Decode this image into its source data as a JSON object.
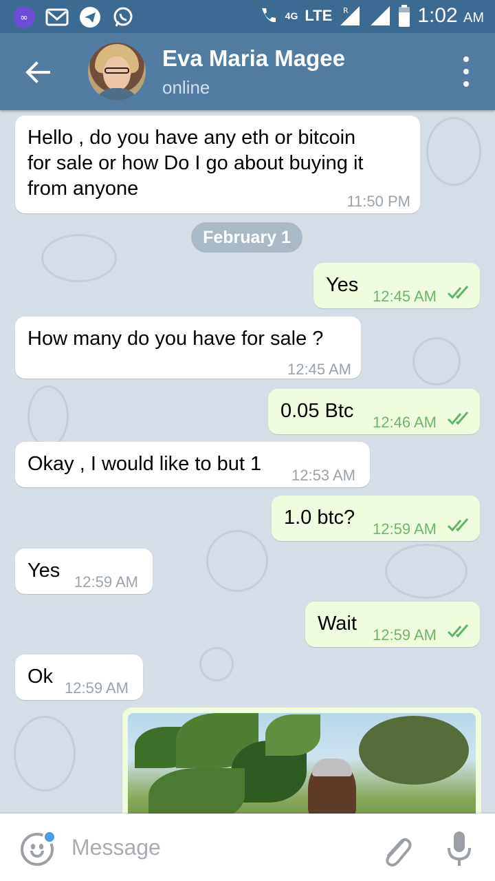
{
  "status_bar": {
    "network": "4G",
    "lte": "LTE",
    "roaming": "R",
    "time": "1:02",
    "ampm": "AM"
  },
  "header": {
    "contact_name": "Eva Maria Magee",
    "status": "online"
  },
  "date_separator": "February 1",
  "messages": [
    {
      "dir": "in",
      "text": "Hello , do you have any eth or bitcoin\nfor sale or how Do I go  about buying it\nfrom anyone",
      "time": "11:50 PM"
    },
    {
      "dir": "out",
      "text": "Yes",
      "time": "12:45 AM"
    },
    {
      "dir": "in",
      "text": "How many do you have for sale ?",
      "time": "12:45 AM"
    },
    {
      "dir": "out",
      "text": "0.05 Btc",
      "time": "12:46 AM"
    },
    {
      "dir": "in",
      "text": "Okay , I would like to but 1",
      "time": "12:53 AM"
    },
    {
      "dir": "out",
      "text": "1.0 btc?",
      "time": "12:59 AM"
    },
    {
      "dir": "in",
      "text": "Yes",
      "time": "12:59 AM"
    },
    {
      "dir": "out",
      "text": "Wait",
      "time": "12:59 AM"
    },
    {
      "dir": "in",
      "text": "Ok",
      "time": "12:59 AM"
    }
  ],
  "input": {
    "placeholder": "Message"
  },
  "colors": {
    "header": "#527da3",
    "status_bar": "#3b6a92",
    "outgoing_bubble": "#effdde",
    "incoming_bubble": "#ffffff",
    "read_check": "#5db565"
  },
  "icons": {
    "back": "arrow-left-icon",
    "menu": "more-vertical-icon",
    "emoji": "smiley-icon",
    "attach": "paperclip-icon",
    "mic": "microphone-icon"
  }
}
